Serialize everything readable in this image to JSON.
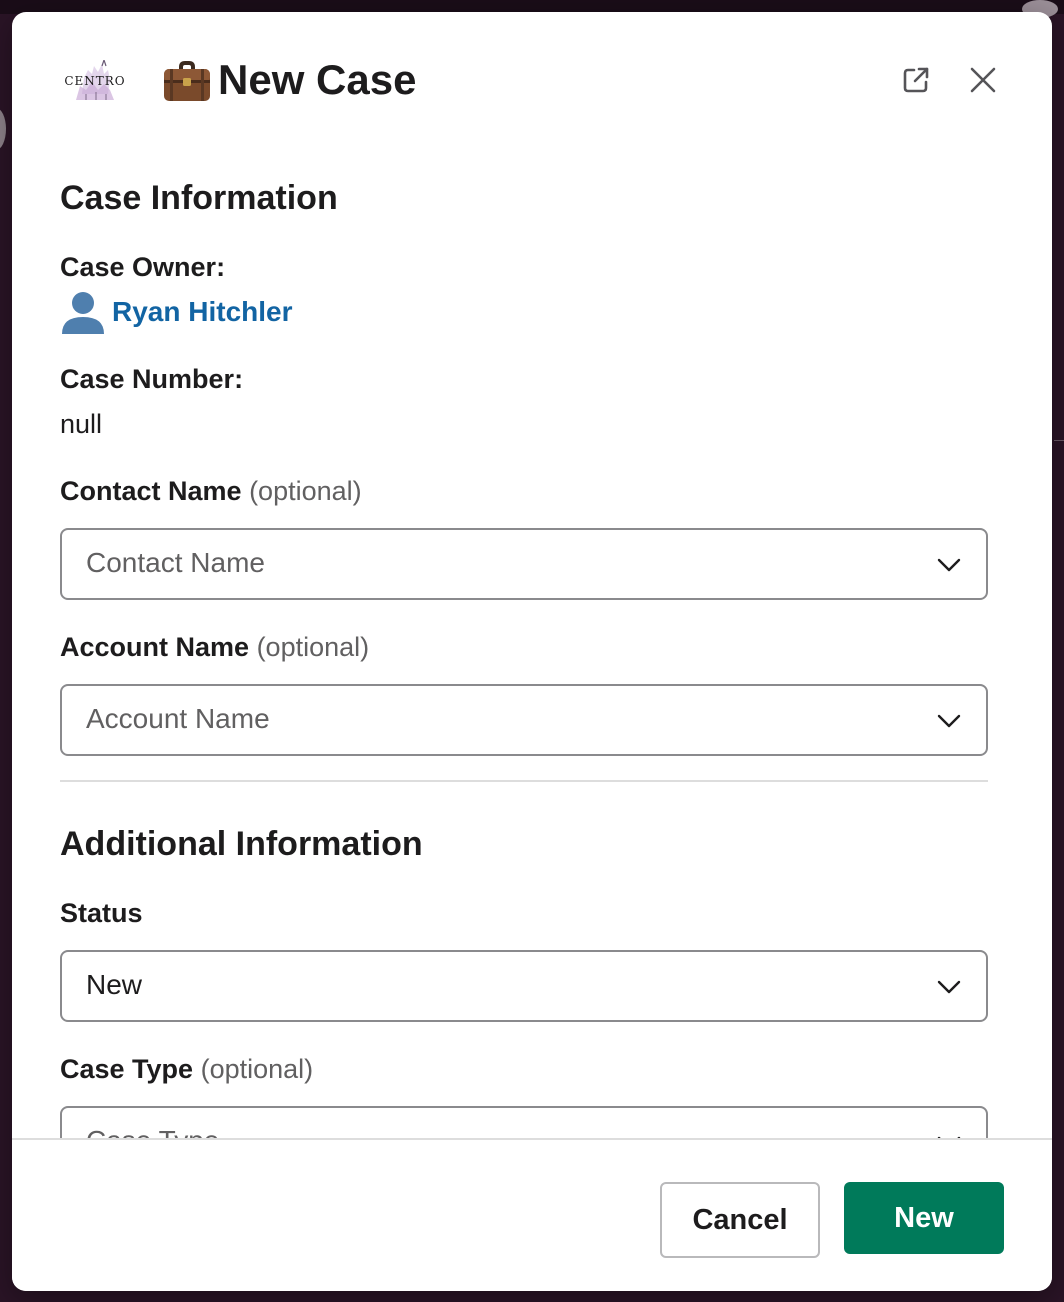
{
  "header": {
    "logo_text": "CENTRO",
    "title": "New Case",
    "title_icon": "briefcase-icon",
    "open_external_icon": "open-external-icon",
    "close_icon": "close-icon"
  },
  "case_information": {
    "heading": "Case Information",
    "case_owner": {
      "label": "Case Owner:",
      "value": "Ryan Hitchler",
      "icon": "user-avatar-icon"
    },
    "case_number": {
      "label": "Case Number:",
      "value": "null"
    },
    "contact_name": {
      "label": "Contact Name",
      "optional": "(optional)",
      "placeholder": "Contact Name"
    },
    "account_name": {
      "label": "Account Name",
      "optional": "(optional)",
      "placeholder": "Account Name"
    }
  },
  "additional_information": {
    "heading": "Additional Information",
    "status": {
      "label": "Status",
      "value": "New"
    },
    "case_type": {
      "label": "Case Type",
      "optional": "(optional)",
      "placeholder": "Case Type"
    }
  },
  "footer": {
    "cancel_label": "Cancel",
    "submit_label": "New"
  },
  "colors": {
    "primary_button": "#007a5a",
    "link": "#1264a3",
    "backdrop": "#2a1426"
  }
}
